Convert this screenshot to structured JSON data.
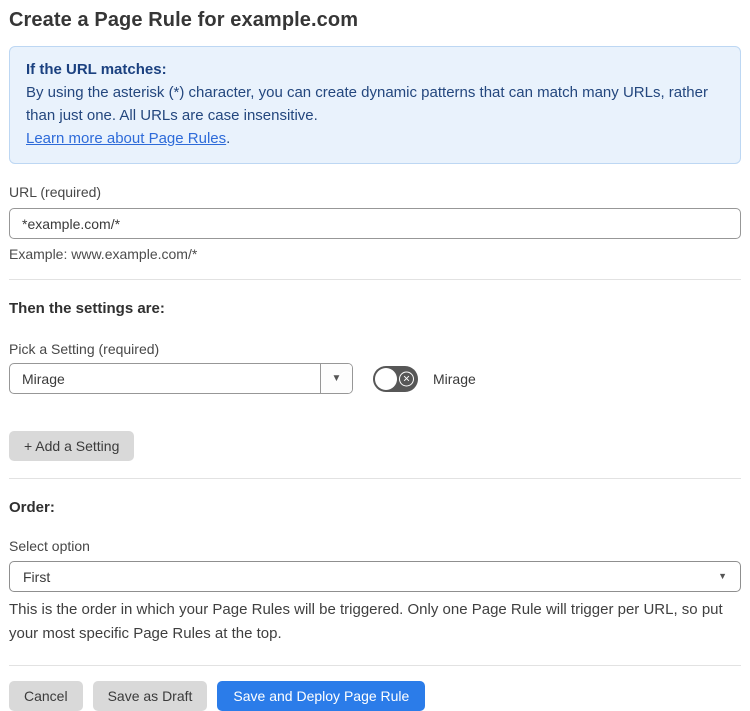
{
  "page": {
    "title": "Create a Page Rule for example.com"
  },
  "info_box": {
    "heading": "If the URL matches:",
    "body": "By using the asterisk (*) character, you can create dynamic patterns that can match many URLs, rather than just one. All URLs are case insensitive.",
    "link_label": "Learn more about Page Rules",
    "link_suffix": "."
  },
  "url_field": {
    "label": "URL (required)",
    "value": "*example.com/*",
    "example": "Example: www.example.com/*"
  },
  "settings_section": {
    "heading": "Then the settings are:",
    "pick_label": "Pick a Setting (required)",
    "selected_setting": "Mirage",
    "toggle_label": "Mirage",
    "toggle_state": "off",
    "add_button_label": "+ Add a Setting"
  },
  "order_section": {
    "heading": "Order:",
    "select_label": "Select option",
    "selected_option": "First",
    "help_text": "This is the order in which your Page Rules will be triggered. Only one Page Rule will trigger per URL, so put your most specific Page Rules at the top."
  },
  "footer": {
    "cancel_label": "Cancel",
    "save_draft_label": "Save as Draft",
    "save_deploy_label": "Save and Deploy Page Rule"
  },
  "icons": {
    "caret_down": "▼",
    "x_mark": "×"
  },
  "colors": {
    "accent_blue": "#2b7ce9",
    "info_bg": "#e9f2fc",
    "info_border": "#bdd7f3",
    "info_text": "#21457e",
    "link_blue": "#2e6bd9",
    "toggle_off_bg": "#575757",
    "gray_button_bg": "#d9d9d9"
  }
}
